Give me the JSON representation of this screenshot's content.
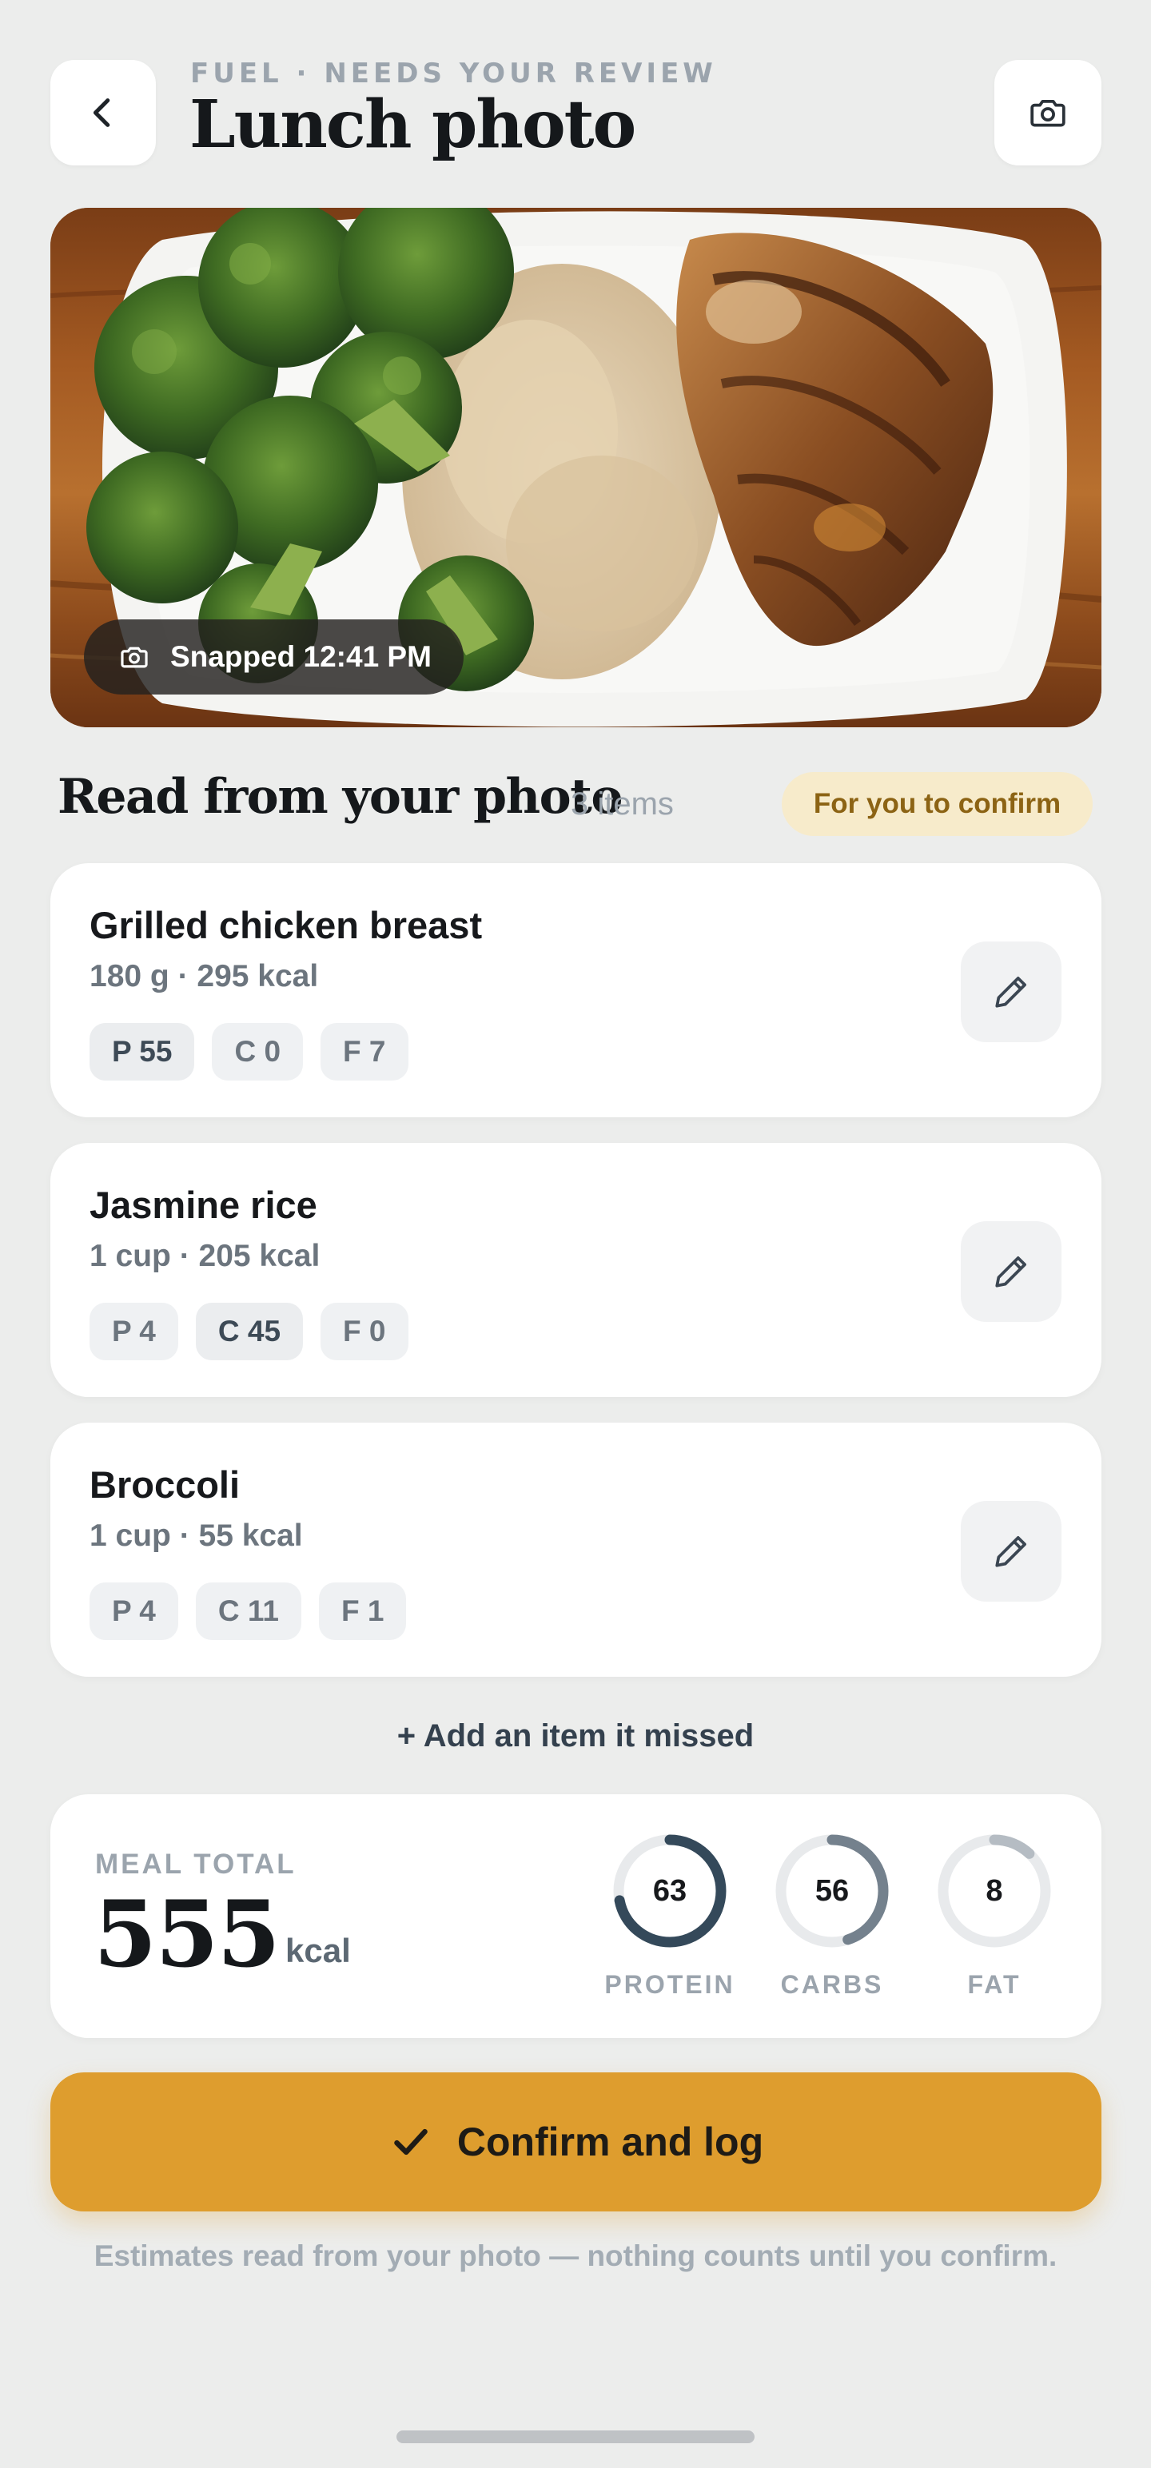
{
  "header": {
    "eyebrow": "FUEL · NEEDS YOUR REVIEW",
    "title": "Lunch photo"
  },
  "photo": {
    "snap_label": "Snapped 12:41 PM"
  },
  "section": {
    "title": "Read from your photo",
    "count": "3 items",
    "badge": "For you to confirm"
  },
  "items": [
    {
      "name": "Grilled chicken breast",
      "meta": "180 g · 295 kcal",
      "macros": {
        "protein": "P 55",
        "carbs": "C 0",
        "fat": "F 7"
      },
      "highlight": "protein"
    },
    {
      "name": "Jasmine rice",
      "meta": "1 cup · 205 kcal",
      "macros": {
        "protein": "P 4",
        "carbs": "C 45",
        "fat": "F 0"
      },
      "highlight": "carbs"
    },
    {
      "name": "Broccoli",
      "meta": "1 cup · 55 kcal",
      "macros": {
        "protein": "P 4",
        "carbs": "C 11",
        "fat": "F 1"
      },
      "highlight": "none"
    }
  ],
  "add_item": "+ Add an item it missed",
  "total": {
    "label": "MEAL TOTAL",
    "value": "555",
    "unit": "kcal",
    "rings": [
      {
        "value": "63",
        "label": "PROTEIN",
        "fill": 0.72,
        "color": "#34495A"
      },
      {
        "value": "56",
        "label": "CARBS",
        "fill": 0.45,
        "color": "#74818D"
      },
      {
        "value": "8",
        "label": "FAT",
        "fill": 0.12,
        "color": "#B5BCC3"
      }
    ]
  },
  "cta": {
    "label": "Confirm and log"
  },
  "footnote": "Estimates read from your photo — nothing counts until you confirm.",
  "colors": {
    "background": "#ECEDEC",
    "accent": "#DE9D2E",
    "badge_bg": "#F7EBCB",
    "badge_text": "#8C6314"
  },
  "icons": {
    "back": "chevron-left-icon",
    "camera": "camera-icon",
    "edit": "pencil-icon",
    "check": "check-icon"
  }
}
